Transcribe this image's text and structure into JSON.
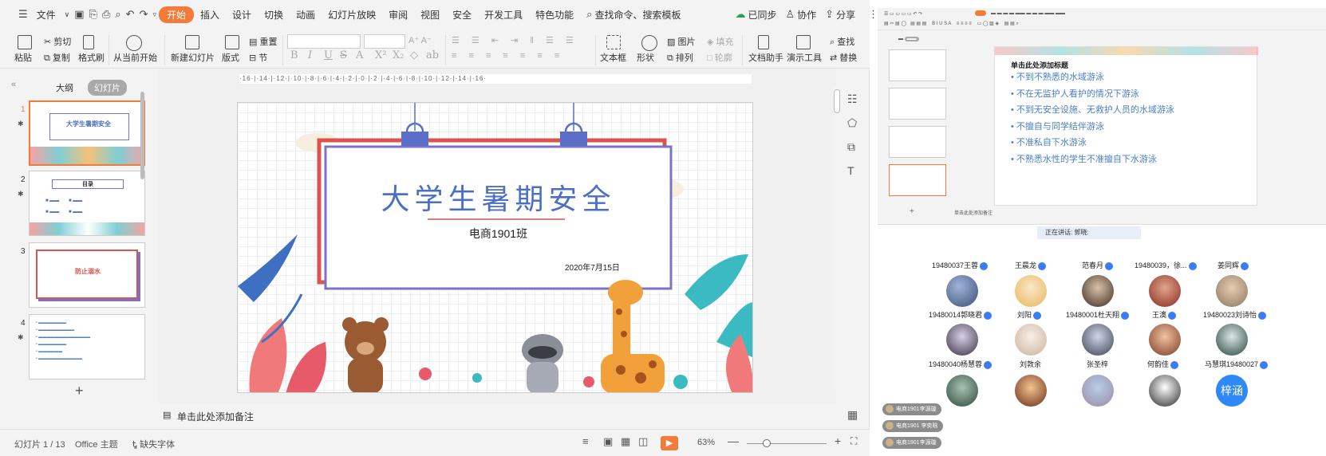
{
  "menubar": {
    "file": "文件",
    "tabs": [
      "开始",
      "插入",
      "设计",
      "切换",
      "动画",
      "幻灯片放映",
      "审阅",
      "视图",
      "安全",
      "开发工具",
      "特色功能"
    ],
    "search": "查找命令、搜索模板",
    "sync": "已同步",
    "collab": "协作",
    "share": "分享"
  },
  "ribbon": {
    "paste": "粘贴",
    "cut": "剪切",
    "copy": "复制",
    "format_painter": "格式刷",
    "from_current": "从当前开始",
    "new_slide": "新建幻灯片",
    "layout": "版式",
    "section": "节",
    "reset": "重置",
    "text_box": "文本框",
    "shape": "形状",
    "picture": "图片",
    "fill": "填充",
    "arrange": "排列",
    "outline": "轮廓",
    "doc_helper": "文档助手",
    "present_tools": "演示工具",
    "find": "查找",
    "replace": "替换"
  },
  "sidebar": {
    "outline_tab": "大纲",
    "slides_tab": "幻灯片",
    "thumbs": [
      {
        "num": "1",
        "title": "大学生暑期安全"
      },
      {
        "num": "2",
        "title": "目录"
      },
      {
        "num": "3",
        "title": "防止溺水"
      },
      {
        "num": "4",
        "title": ""
      }
    ]
  },
  "ruler": "·16·|·14·|·12·|·10·|·8·|·6·|·4·|·2·|·0·|·2·|·4·|·6·|·8·|·10·|·12·|·14·|·16·",
  "slide": {
    "title": "大学生暑期安全",
    "subtitle": "电商1901班",
    "date": "2020年7月15日"
  },
  "notes_placeholder": "单击此处添加备注",
  "status": {
    "slide_count": "幻灯片 1 / 13",
    "theme": "Office 主题",
    "missing_font": "缺失字体",
    "zoom": "63%"
  },
  "right": {
    "slide_heading": "单击此处添加标题",
    "bullets": [
      "不到不熟悉的水域游泳",
      "不在无监护人看护的情况下游泳",
      "不到无安全设施、无救护人员的水域游泳",
      "不擅自与同学结伴游泳",
      "不准私自下水游泳",
      "不熟悉水性的学生不准擅自下水游泳"
    ],
    "notes_placeholder": "单击此处添加备注",
    "speaker": "正在讲话: 郭晓:",
    "participants_row0": [
      "19480037王蓉",
      "王晨龙",
      "范春月",
      "19480039，徐...",
      "姜同辉"
    ],
    "participants_row1": [
      "19480014郭晓君",
      "刘阳",
      "19480001杜天翔",
      "王澳",
      "19480023刘诗怡"
    ],
    "participants_row2": [
      "19480040杨慧蓉",
      "刘敦余",
      "张圣梓",
      "何韵佳",
      "马慧琪19480027"
    ],
    "avatar_text": "梓涵",
    "chat": [
      "电商1901李源璇",
      "电商1901 李奕晗",
      "电商1901李源璇"
    ]
  },
  "colors": {
    "accent": "#f27b3a",
    "title_blue": "#4a6fc5",
    "frame_red": "#d9534f",
    "frame_purple": "#7b73c6",
    "verify_blue": "#3b7cf6"
  }
}
